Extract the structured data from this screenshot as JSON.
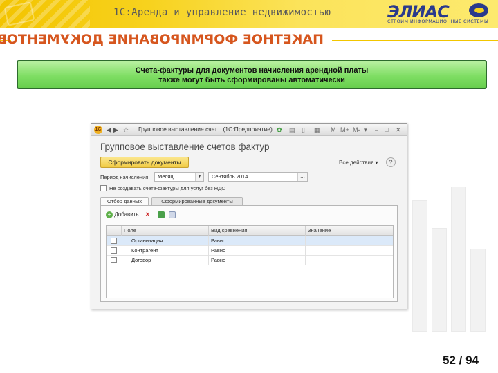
{
  "banner": {
    "title": "1С:Аренда и управление недвижимостью"
  },
  "logo": {
    "name": "ЭЛИАС",
    "subtitle": "СТРОИМ ИНФОРМАЦИОННЫЕ СИСТЕМЫ"
  },
  "heading": "ПАКЕТНОЕ ФОРМИРОВАНИЕ ДОКУМЕНТОВ",
  "info": {
    "line1": "Счета-фактуры для документов начисления арендной платы",
    "line2": "также могут быть сформированы автоматически"
  },
  "window": {
    "titlebar": {
      "logo": "1С",
      "title": "Групповое выставление счет... (1С:Предприятие)",
      "m": "M",
      "m_plus": "M+",
      "m_minus": "M-"
    },
    "form_title": "Групповое выставление счетов фактур",
    "form_button": "Сформировать документы",
    "all_actions": "Все действия ▾",
    "help": "?",
    "period_label": "Период начисления:",
    "period_value": "Месяц",
    "period_month": "Сентябрь 2014",
    "nds_checkbox_label": "Не создавать счета-фактуры для услуг без НДС",
    "tabs": [
      "Отбор данных",
      "Сформированные документы"
    ],
    "toolbar": {
      "add": "Добавить"
    },
    "grid": {
      "columns": [
        "Поле",
        "Вид сравнения",
        "Значение"
      ],
      "rows": [
        {
          "field": "Организация",
          "comparison": "Равно",
          "value": ""
        },
        {
          "field": "Контрагент",
          "comparison": "Равно",
          "value": ""
        },
        {
          "field": "Договор",
          "comparison": "Равно",
          "value": ""
        }
      ]
    }
  },
  "page": {
    "number": "52 / 94"
  },
  "colors": {
    "heading": "#d6561e",
    "accent_yellow": "#f2c600",
    "info_green": "#7fde64",
    "logo_blue": "#2a3a8c"
  }
}
